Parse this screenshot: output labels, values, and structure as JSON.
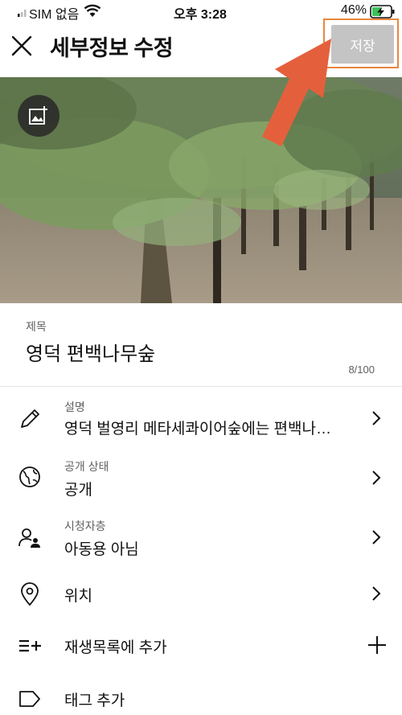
{
  "status": {
    "carrier": "SIM 없음",
    "time": "오후 3:28",
    "battery": "46%"
  },
  "header": {
    "title": "세부정보 수정",
    "save_label": "저장"
  },
  "title_field": {
    "label": "제목",
    "value": "영덕 편백나무숲",
    "counter": "8/100"
  },
  "rows": [
    {
      "sub": "설명",
      "value": "영덕 벌영리 메타세콰이어숲에는 편백나…",
      "icon": "pencil-icon"
    },
    {
      "sub": "공개 상태",
      "value": "공개",
      "icon": "globe-icon"
    },
    {
      "sub": "시청자층",
      "value": "아동용 아님",
      "icon": "audience-icon"
    },
    {
      "value": "위치",
      "icon": "location-pin-icon"
    },
    {
      "value": "재생목록에 추가",
      "icon": "playlist-add-icon"
    },
    {
      "value": "태그 추가",
      "icon": "tag-icon"
    }
  ],
  "colors": {
    "highlight": "#e8863f",
    "arrow": "#e4603c",
    "save_disabled": "#c4c4c4"
  }
}
